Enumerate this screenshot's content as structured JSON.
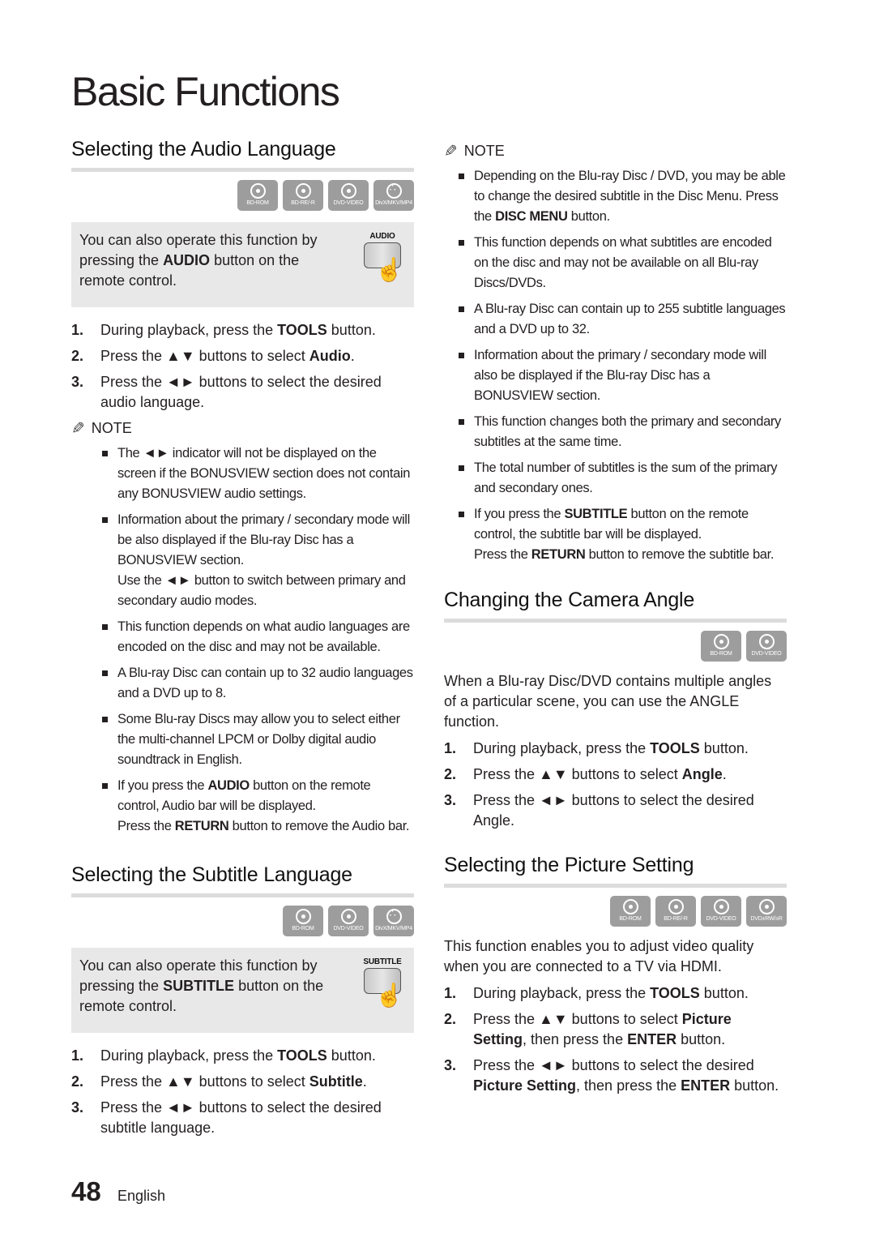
{
  "page": {
    "title": "Basic Functions",
    "page_number": "48",
    "language": "English"
  },
  "audio": {
    "heading": "Selecting the Audio Language",
    "icons": [
      {
        "name": "bd-rom-icon",
        "label": "BD-ROM",
        "kind": "disc"
      },
      {
        "name": "bd-re-r-icon",
        "label": "BD-RE/-R",
        "kind": "disc"
      },
      {
        "name": "dvd-video-icon",
        "label": "DVD-VIDEO",
        "kind": "disc"
      },
      {
        "name": "divx-mkv-mp4-icon",
        "label": "DivX/MKV/MP4",
        "kind": "reel"
      }
    ],
    "tip": {
      "pre": "You can also operate this function by pressing the ",
      "bold": "AUDIO",
      "post": " button on the remote control.",
      "button_label": "AUDIO"
    },
    "steps": [
      {
        "num": "1.",
        "pre": "During playback, press the ",
        "bold": "TOOLS",
        "post": " button."
      },
      {
        "num": "2.",
        "pre": "Press the ▲▼ buttons to select ",
        "bold": "Audio",
        "post": "."
      },
      {
        "num": "3.",
        "pre": "Press the ◄► buttons to select the desired audio language.",
        "bold": "",
        "post": ""
      }
    ],
    "note_label": "NOTE",
    "notes": [
      {
        "pre": "The ◄► indicator will not be displayed on the screen if the BONUSVIEW section does not contain any BONUSVIEW audio settings.",
        "bold": "",
        "post": "",
        "extra_pre": "",
        "extra_bold": "",
        "extra_post": ""
      },
      {
        "pre": "Information about the primary / secondary mode will be also displayed if the Blu-ray Disc has a BONUSVIEW section.",
        "bold": "",
        "post": "",
        "extra_pre": "Use the ◄► button to switch between primary and secondary audio modes.",
        "extra_bold": "",
        "extra_post": ""
      },
      {
        "pre": "This function depends on what audio languages are encoded on the disc and may not be available.",
        "bold": "",
        "post": "",
        "extra_pre": "",
        "extra_bold": "",
        "extra_post": ""
      },
      {
        "pre": "A Blu-ray Disc can contain up to 32 audio languages and a DVD up to 8.",
        "bold": "",
        "post": "",
        "extra_pre": "",
        "extra_bold": "",
        "extra_post": ""
      },
      {
        "pre": "Some Blu-ray Discs may allow you to select either the multi-channel LPCM or Dolby digital audio soundtrack in English.",
        "bold": "",
        "post": "",
        "extra_pre": "",
        "extra_bold": "",
        "extra_post": ""
      },
      {
        "pre": "If you press the ",
        "bold": "AUDIO",
        "post": " button on the remote control, Audio bar will be displayed.",
        "extra_pre": "Press the ",
        "extra_bold": "RETURN",
        "extra_post": " button to remove the Audio bar."
      }
    ]
  },
  "subtitle": {
    "heading": "Selecting the Subtitle Language",
    "icons": [
      {
        "name": "bd-rom-icon",
        "label": "BD-ROM",
        "kind": "disc"
      },
      {
        "name": "dvd-video-icon",
        "label": "DVD-VIDEO",
        "kind": "disc"
      },
      {
        "name": "divx-mkv-mp4-icon",
        "label": "DivX/MKV/MP4",
        "kind": "reel"
      }
    ],
    "tip": {
      "pre": "You can also operate this function by pressing the ",
      "bold": "SUBTITLE",
      "post": " button on the remote control.",
      "button_label": "SUBTITLE"
    },
    "steps": [
      {
        "num": "1.",
        "pre": "During playback, press the ",
        "bold": "TOOLS",
        "post": " button."
      },
      {
        "num": "2.",
        "pre": "Press the ▲▼ buttons to select ",
        "bold": "Subtitle",
        "post": "."
      },
      {
        "num": "3.",
        "pre": "Press the ◄► buttons to select the desired subtitle language.",
        "bold": "",
        "post": ""
      }
    ],
    "note_label": "NOTE",
    "notes": [
      {
        "pre": "Depending on the Blu-ray Disc / DVD, you may be able to change the desired subtitle in the Disc Menu.",
        "bold": "",
        "post": "",
        "extra_pre": "Press the ",
        "extra_bold": "DISC MENU",
        "extra_post": " button.",
        "inline_extra": true
      },
      {
        "pre": "This function depends on what subtitles are encoded on the disc and may not be available on all Blu-ray Discs/DVDs.",
        "bold": "",
        "post": "",
        "extra_pre": "",
        "extra_bold": "",
        "extra_post": ""
      },
      {
        "pre": "A Blu-ray Disc can contain up to 255 subtitle languages and a DVD up to 32.",
        "bold": "",
        "post": "",
        "extra_pre": "",
        "extra_bold": "",
        "extra_post": ""
      },
      {
        "pre": "Information about the primary / secondary mode will also be displayed if the Blu-ray Disc has a BONUSVIEW section.",
        "bold": "",
        "post": "",
        "extra_pre": "",
        "extra_bold": "",
        "extra_post": ""
      },
      {
        "pre": "This function changes both the primary and secondary subtitles at the same time.",
        "bold": "",
        "post": "",
        "extra_pre": "",
        "extra_bold": "",
        "extra_post": ""
      },
      {
        "pre": "The total number of subtitles is the sum of the primary and secondary ones.",
        "bold": "",
        "post": "",
        "extra_pre": "",
        "extra_bold": "",
        "extra_post": ""
      },
      {
        "pre": "If you press the ",
        "bold": "SUBTITLE",
        "post": " button on the remote control, the subtitle bar will be displayed.",
        "extra_pre": "Press the ",
        "extra_bold": "RETURN",
        "extra_post": " button to remove the subtitle bar."
      }
    ]
  },
  "angle": {
    "heading": "Changing the Camera Angle",
    "icons": [
      {
        "name": "bd-rom-icon",
        "label": "BD-ROM",
        "kind": "disc"
      },
      {
        "name": "dvd-video-icon",
        "label": "DVD-VIDEO",
        "kind": "disc"
      }
    ],
    "intro": "When a Blu-ray Disc/DVD contains multiple angles of a particular scene, you can use the ANGLE function.",
    "steps": [
      {
        "num": "1.",
        "pre": "During playback, press the ",
        "bold": "TOOLS",
        "post": " button."
      },
      {
        "num": "2.",
        "pre": "Press the ▲▼ buttons to select ",
        "bold": "Angle",
        "post": "."
      },
      {
        "num": "3.",
        "pre": "Press the ◄► buttons to select the desired Angle.",
        "bold": "",
        "post": ""
      }
    ]
  },
  "picture": {
    "heading": "Selecting the Picture Setting",
    "icons": [
      {
        "name": "bd-rom-icon",
        "label": "BD-ROM",
        "kind": "disc"
      },
      {
        "name": "bd-re-r-icon",
        "label": "BD-RE/-R",
        "kind": "disc"
      },
      {
        "name": "dvd-video-icon",
        "label": "DVD-VIDEO",
        "kind": "disc"
      },
      {
        "name": "dvd-rw-r-icon",
        "label": "DVD±RW/±R",
        "kind": "disc"
      }
    ],
    "intro": "This function enables you to adjust video quality when you are connected to a TV via HDMI.",
    "steps": [
      {
        "num": "1.",
        "pre": "During playback, press the ",
        "bold": "TOOLS",
        "post": " button."
      },
      {
        "num": "2.",
        "pre": "Press the ▲▼ buttons to select ",
        "bold": "Picture Setting",
        "post": ", then press the ",
        "bold2": "ENTER",
        "post2": " button."
      },
      {
        "num": "3.",
        "pre": "Press the ◄► buttons to select the desired ",
        "bold": "Picture Setting",
        "post": ", then press the ",
        "bold2": "ENTER",
        "post2": " button."
      }
    ]
  }
}
